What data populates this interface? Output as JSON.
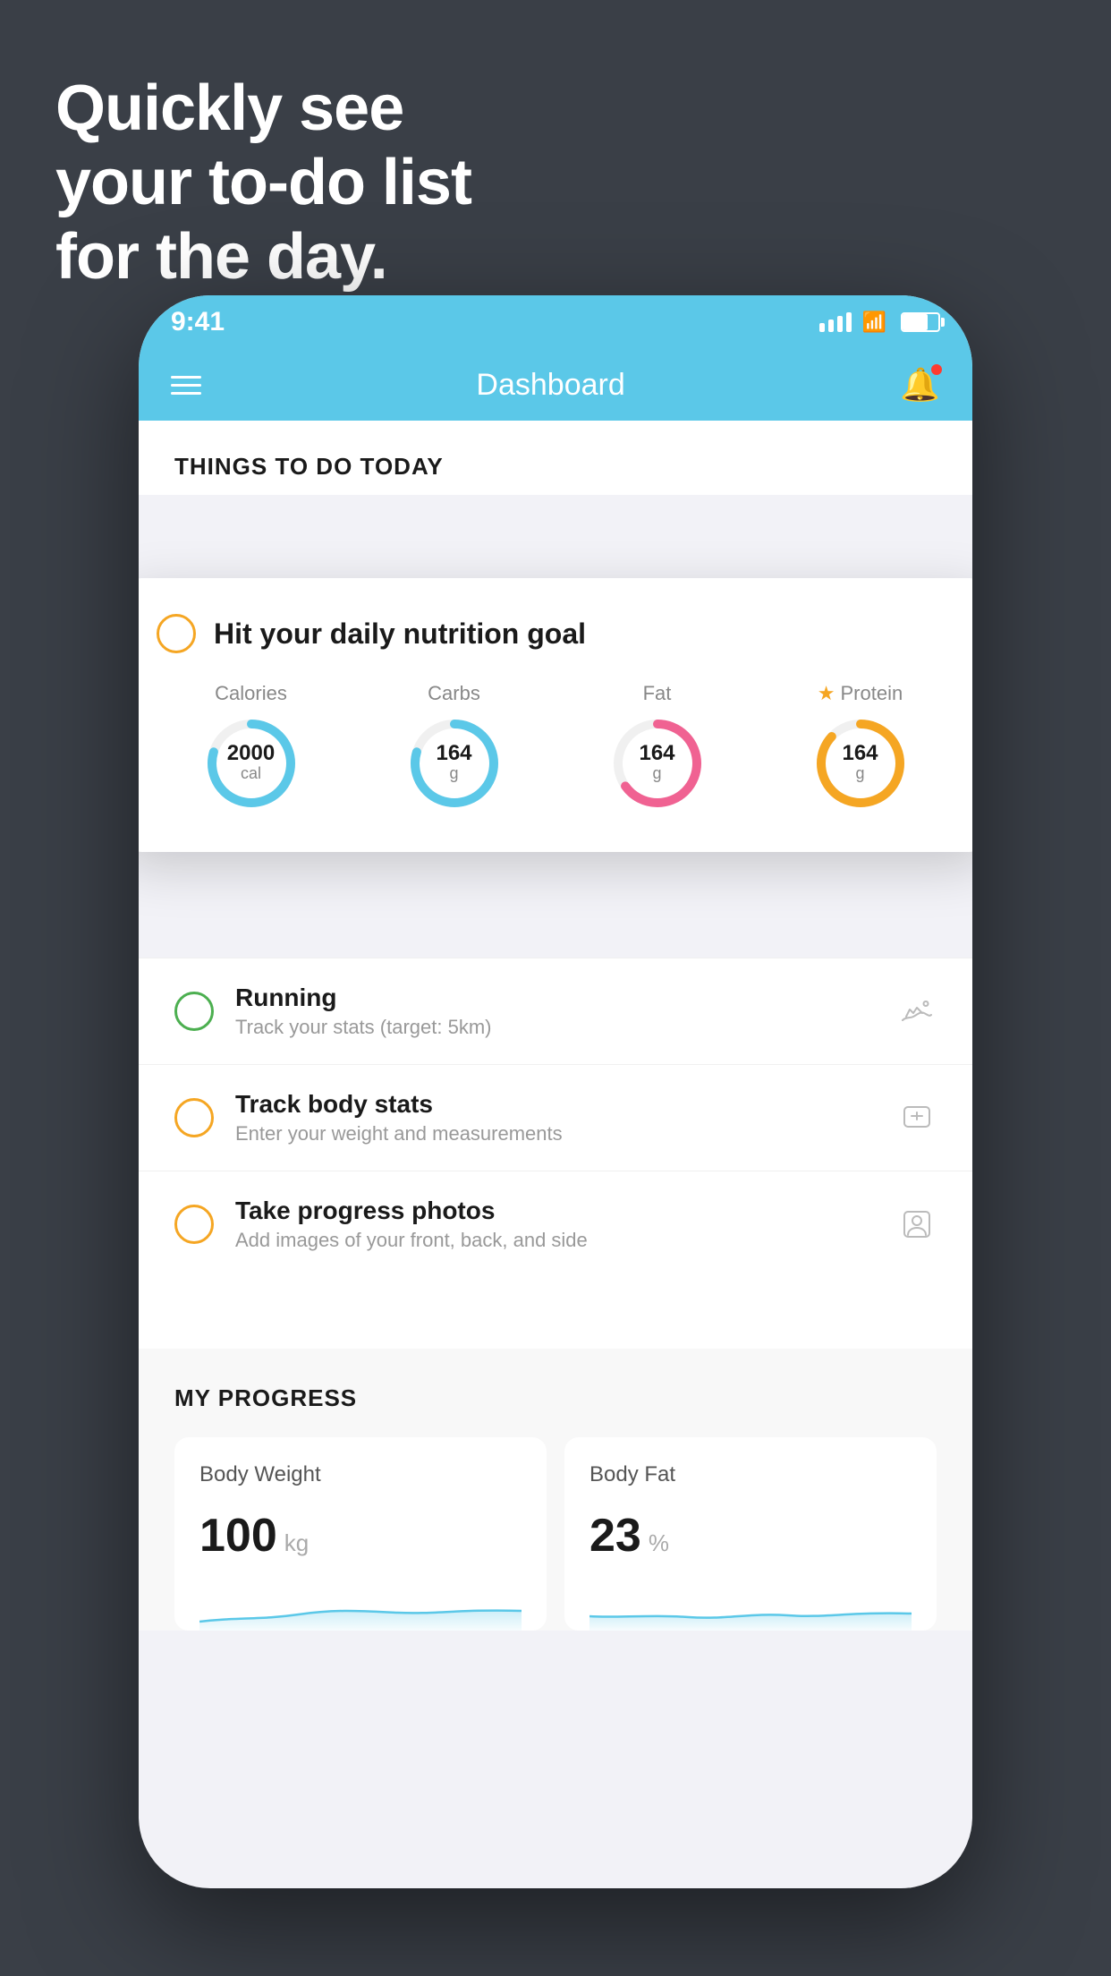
{
  "hero": {
    "line1": "Quickly see",
    "line2": "your to-do list",
    "line3": "for the day."
  },
  "status_bar": {
    "time": "9:41",
    "signal_label": "signal",
    "wifi_label": "wifi",
    "battery_label": "battery"
  },
  "nav": {
    "title": "Dashboard",
    "menu_label": "menu",
    "bell_label": "notifications"
  },
  "things_today": {
    "section_label": "THINGS TO DO TODAY"
  },
  "nutrition_card": {
    "title": "Hit your daily nutrition goal",
    "items": [
      {
        "label": "Calories",
        "value": "2000",
        "unit": "cal",
        "type": "blue",
        "star": false
      },
      {
        "label": "Carbs",
        "value": "164",
        "unit": "g",
        "type": "blue",
        "star": false
      },
      {
        "label": "Fat",
        "value": "164",
        "unit": "g",
        "type": "pink",
        "star": false
      },
      {
        "label": "Protein",
        "value": "164",
        "unit": "g",
        "type": "gold",
        "star": true
      }
    ]
  },
  "todo_items": [
    {
      "title": "Running",
      "subtitle": "Track your stats (target: 5km)",
      "circle_color": "green",
      "icon": "shoe"
    },
    {
      "title": "Track body stats",
      "subtitle": "Enter your weight and measurements",
      "circle_color": "gold",
      "icon": "scale"
    },
    {
      "title": "Take progress photos",
      "subtitle": "Add images of your front, back, and side",
      "circle_color": "gold",
      "icon": "person"
    }
  ],
  "progress": {
    "section_label": "MY PROGRESS",
    "cards": [
      {
        "title": "Body Weight",
        "value": "100",
        "unit": "kg"
      },
      {
        "title": "Body Fat",
        "value": "23",
        "unit": "%"
      }
    ]
  }
}
